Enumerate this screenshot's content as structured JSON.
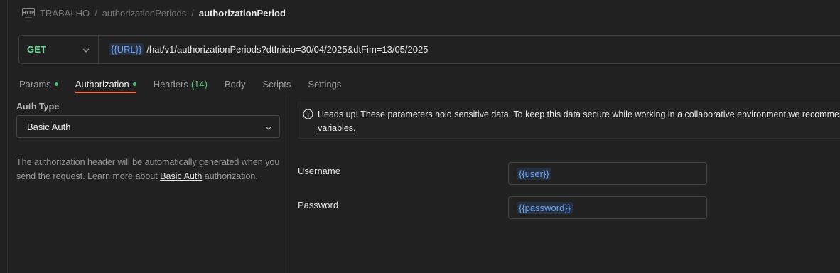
{
  "breadcrumb": {
    "icon": "http-icon",
    "items": [
      "TRABALHO",
      "authorizationPeriods"
    ],
    "separator": "/",
    "current": "authorizationPeriod"
  },
  "request": {
    "method": "GET",
    "url_variable": "{{URL}}",
    "url_path": "/hat/v1/authorizationPeriods?dtInicio=30/04/2025&dtFim=13/05/2025"
  },
  "tabs": [
    {
      "label": "Params",
      "dot": true,
      "count": ""
    },
    {
      "label": "Authorization",
      "dot": true,
      "count": "",
      "active": true
    },
    {
      "label": "Headers",
      "dot": false,
      "count": "(14)"
    },
    {
      "label": "Body",
      "dot": false,
      "count": ""
    },
    {
      "label": "Scripts",
      "dot": false,
      "count": ""
    },
    {
      "label": "Settings",
      "dot": false,
      "count": ""
    }
  ],
  "auth": {
    "type_label": "Auth Type",
    "type_value": "Basic Auth",
    "description_before": "The authorization header will be automatically generated when you send the request. Learn more about ",
    "description_link": "Basic Auth",
    "description_after": " authorization."
  },
  "banner": {
    "text": "Heads up! These parameters hold sensitive data. To keep this data secure while working in a collaborative environment,we recommend using",
    "link": "variables",
    "after": "."
  },
  "fields": {
    "username_label": "Username",
    "username_value": "{{user}}",
    "password_label": "Password",
    "password_value": "{{password}}"
  },
  "colors": {
    "method_get": "#6bdd9a",
    "variable": "#6aa5ff",
    "active_tab_underline": "#ff6c37",
    "status_dot": "#4cc07a"
  }
}
